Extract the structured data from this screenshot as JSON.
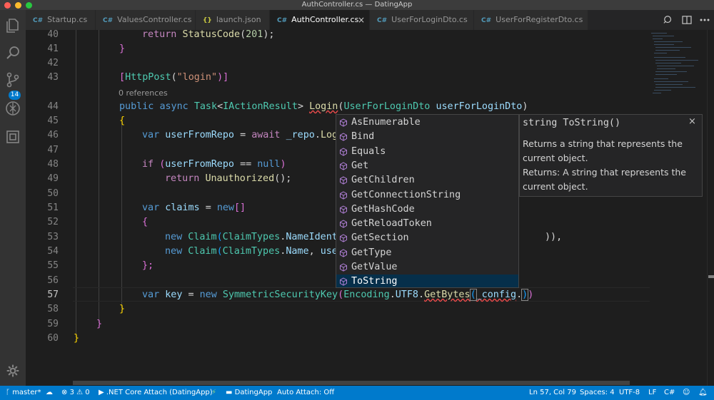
{
  "window": {
    "title": "AuthController.cs — DatingApp"
  },
  "activity_bar": {
    "scm_badge": "14"
  },
  "tabs": [
    {
      "icon": "C#",
      "label": "Startup.cs"
    },
    {
      "icon": "C#",
      "label": "ValuesController.cs"
    },
    {
      "icon": "{}",
      "label": "launch.json"
    },
    {
      "icon": "C#",
      "label": "AuthController.cs",
      "close": "×"
    },
    {
      "icon": "C#",
      "label": "UserForLoginDto.cs"
    },
    {
      "icon": "C#",
      "label": "UserForRegisterDto.cs"
    }
  ],
  "editor": {
    "line_numbers": [
      "40",
      "41",
      "42",
      "43",
      "44",
      "45",
      "46",
      "47",
      "48",
      "49",
      "50",
      "51",
      "52",
      "53",
      "54",
      "55",
      "56",
      "57",
      "58",
      "59",
      "60"
    ],
    "codelens": "0 references",
    "lines": {
      "l40": [
        "return",
        "StatusCode",
        "(",
        "201",
        ");"
      ],
      "l41": "}",
      "l43": [
        "[",
        "HttpPost",
        "(",
        "\"login\"",
        ")]"
      ],
      "l44": [
        "public",
        "async",
        "Task",
        "<",
        "IActionResult",
        ">",
        "Login",
        "(",
        "UserForLoginDto",
        "userForLoginDto",
        ")"
      ],
      "l45": "{",
      "l46": [
        "var",
        "userFromRepo",
        "=",
        "await",
        "_repo",
        ".",
        "Log"
      ],
      "l48": [
        "if",
        "(",
        "userFromRepo",
        "==",
        "null",
        ")"
      ],
      "l49": [
        "return",
        "Unauthorized",
        "();"
      ],
      "l51": [
        "var",
        "claims",
        "=",
        "new",
        "[]"
      ],
      "l52": "{",
      "l53": [
        "new",
        "Claim",
        "(",
        "ClaimTypes",
        ".",
        "NameIdent",
        ")),"
      ],
      "l54": [
        "new",
        "Claim",
        "(",
        "ClaimTypes",
        ".",
        "Name",
        ",",
        "use"
      ],
      "l55": "};",
      "l57": [
        "var",
        "key",
        "=",
        "new",
        "SymmetricSecurityKey",
        "(",
        "Encoding",
        ".",
        "UTF8",
        ".",
        "GetBytes",
        "(",
        "_config",
        ".",
        ")",
        ")"
      ],
      "l58": "}",
      "l59": "}",
      "l60": "}"
    }
  },
  "suggest": {
    "items": [
      "AsEnumerable",
      "Bind",
      "Equals",
      "Get",
      "GetChildren",
      "GetConnectionString",
      "GetHashCode",
      "GetReloadToken",
      "GetSection",
      "GetType",
      "GetValue",
      "ToString"
    ],
    "selected": "ToString"
  },
  "docs": {
    "signature": "string ToString()",
    "close": "×",
    "lines": [
      "Returns a string that represents the",
      "current object.",
      "Returns: A string that represents the",
      "current object."
    ]
  },
  "status": {
    "branch": "master*",
    "errors": "3",
    "warnings": "0",
    "debug": ".NET Core Attach (DatingApp)",
    "folder": "DatingApp",
    "auto_attach": "Auto Attach: Off",
    "position": "Ln 57, Col 79",
    "spaces": "Spaces: 4",
    "encoding": "UTF-8",
    "eol": "LF",
    "language": "C#"
  }
}
